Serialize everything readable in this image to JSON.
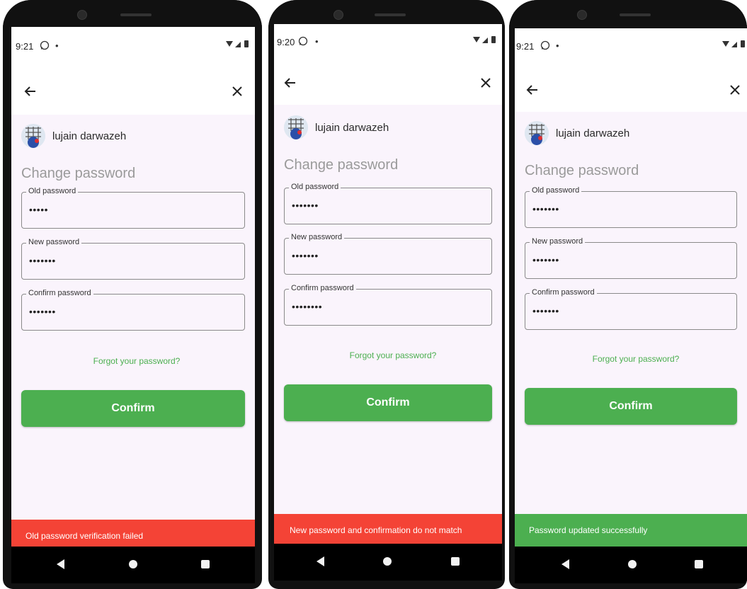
{
  "colors": {
    "accent_green": "#4caf50",
    "error_red": "#f44336",
    "screen_bg": "#faf4fc"
  },
  "screens": [
    {
      "status_time": "9:21",
      "status_dot": "•",
      "user_name": "lujain darwazeh",
      "title": "Change password",
      "old_label": "Old password",
      "old_value": "•••••",
      "new_label": "New password",
      "new_value": "•••••••",
      "confirm_label": "Confirm password",
      "confirm_value": "•••••••",
      "forgot_link": "Forgot your password?",
      "confirm_button": "Confirm",
      "snackbar_text": "Old password verification failed",
      "snackbar_color": "#f44336"
    },
    {
      "status_time": "9:20",
      "status_dot": "•",
      "user_name": "lujain darwazeh",
      "title": "Change password",
      "old_label": "Old password",
      "old_value": "•••••••",
      "new_label": "New password",
      "new_value": "•••••••",
      "confirm_label": "Confirm password",
      "confirm_value": "••••••••",
      "forgot_link": "Forgot your password?",
      "confirm_button": "Confirm",
      "snackbar_text": "New password and confirmation do not match",
      "snackbar_color": "#f44336"
    },
    {
      "status_time": "9:21",
      "status_dot": "•",
      "user_name": "lujain darwazeh",
      "title": "Change password",
      "old_label": "Old password",
      "old_value": "•••••••",
      "new_label": "New password",
      "new_value": "•••••••",
      "confirm_label": "Confirm password",
      "confirm_value": "•••••••",
      "forgot_link": "Forgot your password?",
      "confirm_button": "Confirm",
      "snackbar_text": "Password updated successfully",
      "snackbar_color": "#4caf50"
    }
  ]
}
